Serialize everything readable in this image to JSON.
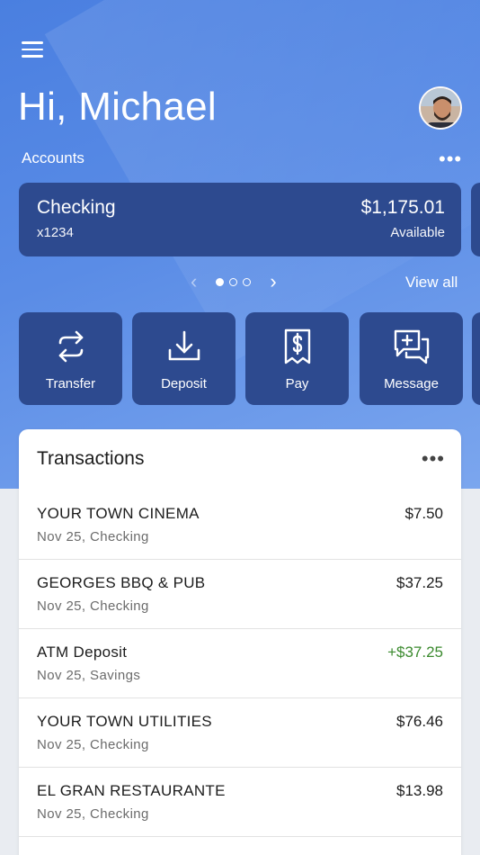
{
  "header": {
    "greeting": "Hi, Michael",
    "accounts_label": "Accounts",
    "more_glyph": "•••"
  },
  "account": {
    "name": "Checking",
    "number": "x1234",
    "balance": "$1,175.01",
    "balance_label": "Available"
  },
  "pager": {
    "page_count": 3,
    "active_page": 1,
    "view_all": "View all"
  },
  "actions": [
    {
      "label": "Transfer",
      "icon": "transfer-icon"
    },
    {
      "label": "Deposit",
      "icon": "deposit-icon"
    },
    {
      "label": "Pay",
      "icon": "pay-bill-icon"
    },
    {
      "label": "Message",
      "icon": "message-icon"
    }
  ],
  "transactions": {
    "title": "Transactions",
    "items": [
      {
        "merchant": "YOUR TOWN CINEMA",
        "meta": "Nov 25, Checking",
        "amount": "$7.50",
        "type": "debit"
      },
      {
        "merchant": "GEORGES BBQ & PUB",
        "meta": "Nov 25, Checking",
        "amount": "$37.25",
        "type": "debit"
      },
      {
        "merchant": "ATM Deposit",
        "meta": "Nov 25, Savings",
        "amount": "+$37.25",
        "type": "credit"
      },
      {
        "merchant": "YOUR TOWN UTILITIES",
        "meta": "Nov 25, Checking",
        "amount": "$76.46",
        "type": "debit"
      },
      {
        "merchant": "EL GRAN RESTAURANTE",
        "meta": "Nov 25, Checking",
        "amount": "$13.98",
        "type": "debit"
      }
    ]
  },
  "colors": {
    "hero_gradient_start": "#4a7fe0",
    "card": "#2d4a8f",
    "credit": "#3b8a2e",
    "background": "#e9ecf1"
  }
}
